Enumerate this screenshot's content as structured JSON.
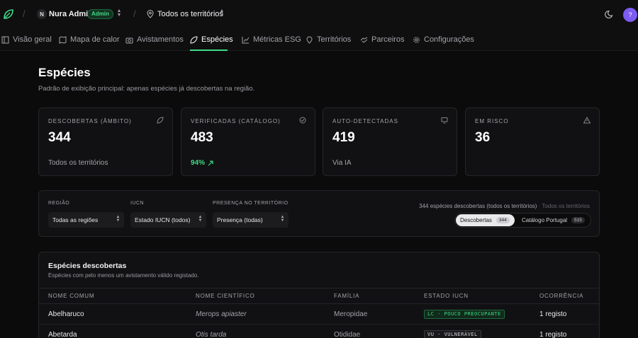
{
  "header": {
    "org_initial": "N",
    "org_name": "Nura Admin",
    "role_badge": "Admin",
    "territory": "Todos os territórios",
    "user_initial": "?",
    "separator": "/"
  },
  "nav": {
    "tabs": [
      {
        "label": "Visão geral",
        "icon": "grid-icon"
      },
      {
        "label": "Mapa de calor",
        "icon": "map-icon"
      },
      {
        "label": "Avistamentos",
        "icon": "camera-icon"
      },
      {
        "label": "Espécies",
        "icon": "leaf-icon",
        "active": true
      },
      {
        "label": "Métricas ESG",
        "icon": "chart-icon"
      },
      {
        "label": "Territórios",
        "icon": "pin-icon"
      },
      {
        "label": "Parceiros",
        "icon": "handshake-icon"
      },
      {
        "label": "Configurações",
        "icon": "gear-icon"
      }
    ]
  },
  "page": {
    "title": "Espécies",
    "subtitle": "Padrão de exibição principal: apenas espécies já descobertas na região."
  },
  "stats": [
    {
      "label": "DESCOBERTAS (ÂMBITO)",
      "value": "344",
      "foot": "Todos os territórios",
      "icon": "leaf-icon"
    },
    {
      "label": "VERIFICADAS (CATÁLOGO)",
      "value": "483",
      "foot": "94%",
      "icon": "check-circle-icon"
    },
    {
      "label": "AUTO-DETECTADAS",
      "value": "419",
      "foot": "Via IA",
      "icon": "monitor-icon"
    },
    {
      "label": "EM RISCO",
      "value": "36",
      "foot": "",
      "icon": "warning-icon"
    }
  ],
  "filters": {
    "region_label": "REGIÃO",
    "region_value": "Todas as regiões",
    "iucn_label": "IUCN",
    "iucn_value": "Estado IUCN (todos)",
    "presence_label": "PRESENÇA NO TERRITÓRIO",
    "presence_value": "Presença (todas)",
    "count_text": "344 espécies descobertas (todos os territórios)",
    "count_suffix": " · Todos os territórios",
    "seg_discovered_label": "Descobertas",
    "seg_discovered_count": "344",
    "seg_catalog_label": "Catálogo Portugal",
    "seg_catalog_count": "515"
  },
  "table": {
    "title": "Espécies descobertas",
    "subtitle": "Espécies com pelo menos um avistamento válido registado.",
    "headers": [
      "NOME COMUM",
      "NOME CIENTÍFICO",
      "FAMÍLIA",
      "ESTADO IUCN",
      "OCORRÊNCIA"
    ],
    "rows": [
      {
        "common": "Abelharuco",
        "scientific": "Merops apiaster",
        "family": "Meropidae",
        "iucn": "LC · POUCO PREOCUPANTE",
        "occurrence": "1 registo"
      },
      {
        "common": "Abetarda",
        "scientific": "Otis tarda",
        "family": "Otididae",
        "iucn": "VU · VULNERÁVEL",
        "occurrence": "1 registo"
      }
    ]
  },
  "colors": {
    "accent": "#3ddc84",
    "avatar": "#7c5cf0",
    "background": "#0b0b0c"
  }
}
